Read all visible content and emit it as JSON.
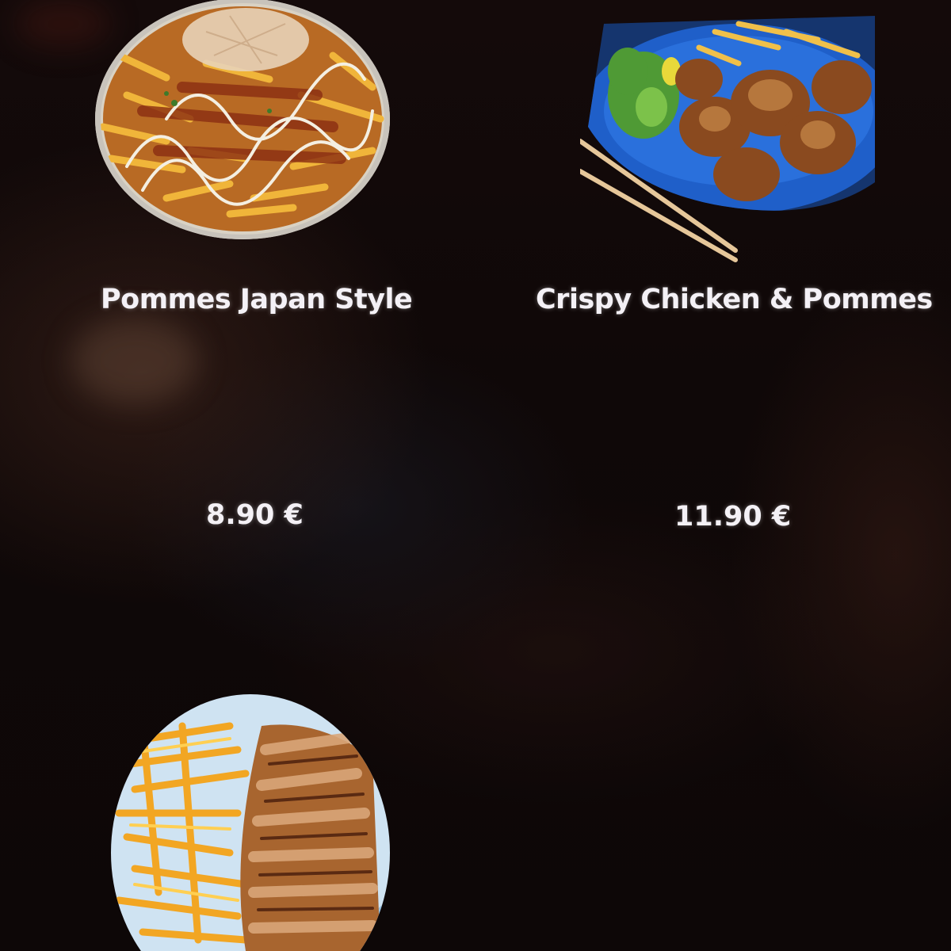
{
  "menu": {
    "items": [
      {
        "name": "Pommes Japan Style",
        "price": "8.90 €",
        "image": "fries-okonomi-bowl-icon"
      },
      {
        "name": "Crispy Chicken & Pommes",
        "price": "11.90 €",
        "image": "fried-chicken-plate-icon"
      },
      {
        "name": "",
        "price": "",
        "image": "chicken-fries-plate-icon"
      }
    ]
  },
  "colors": {
    "background": "#0c0708",
    "text": "#f4f1f6",
    "plate_blue": "#1f5fc9",
    "fries": "#f2a623"
  }
}
